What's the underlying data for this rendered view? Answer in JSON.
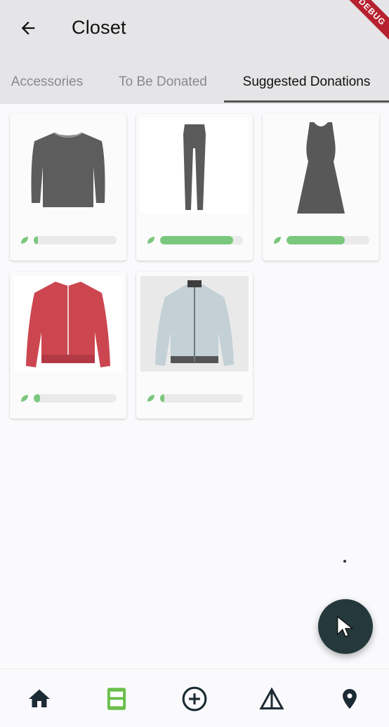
{
  "app_bar": {
    "title": "Closet",
    "debug_label": "DEBUG",
    "back_icon": "arrow-left-icon"
  },
  "tabs": [
    {
      "label": "Accessories",
      "active": false
    },
    {
      "label": "To Be Donated",
      "active": false
    },
    {
      "label": "Suggested Donations",
      "active": true
    }
  ],
  "items": [
    {
      "name": "gray-sweater",
      "icon": "sweater-icon",
      "progress": 0.05
    },
    {
      "name": "gray-jeans",
      "icon": "jeans-icon",
      "progress": 0.88
    },
    {
      "name": "gray-dress",
      "icon": "dress-icon",
      "progress": 0.7
    },
    {
      "name": "red-jacket",
      "icon": "jacket-icon",
      "progress": 0.08
    },
    {
      "name": "bomber-jacket",
      "icon": "bomber-icon",
      "progress": 0.03
    }
  ],
  "colors": {
    "app_bar_bg": "#e5e5e7",
    "progress_fill": "#7ac77d",
    "fab_bg": "#25393c",
    "closet_icon_active": "#6abf4b",
    "nav_icon": "#1c2b33"
  },
  "bottom_nav": [
    {
      "icon": "home-icon",
      "active": false
    },
    {
      "icon": "closet-icon",
      "active": true
    },
    {
      "icon": "add-circle-icon",
      "active": false
    },
    {
      "icon": "hanger-icon",
      "active": false
    },
    {
      "icon": "location-pin-icon",
      "active": false
    }
  ],
  "fab": {
    "icon": "cursor-icon"
  }
}
